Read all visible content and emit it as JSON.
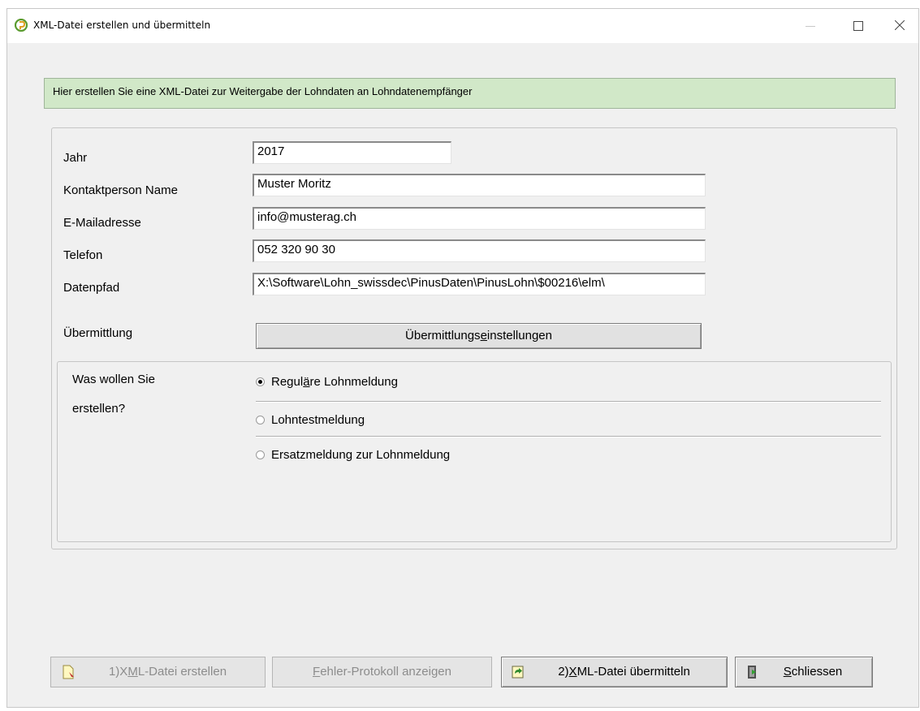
{
  "window": {
    "title": "XML-Datei erstellen und übermitteln"
  },
  "info": {
    "text": "Hier erstellen Sie eine XML-Datei zur Weitergabe der Lohndaten an Lohndatenempfänger"
  },
  "form": {
    "jahr_label": "Jahr",
    "jahr_value": "2017",
    "kontakt_label": "Kontaktperson Name",
    "kontakt_value": "Muster Moritz",
    "email_label": "E-Mailadresse",
    "email_value": "info@musterag.ch",
    "telefon_label": "Telefon",
    "telefon_value": "052 320 90 30",
    "pfad_label": "Datenpfad",
    "pfad_value": "X:\\Software\\Lohn_swissdec\\PinusDaten\\PinusLohn\\$00216\\elm\\",
    "uebermittlung_label": "Übermittlung",
    "settings_button": {
      "pre": "Übermittlungs",
      "key": "e",
      "post": "instellungen"
    }
  },
  "options": {
    "question_line1": "Was wollen Sie",
    "question_line2": "erstellen?",
    "items": [
      {
        "pre": "Regul",
        "key": "ä",
        "post": "re Lohnmeldung",
        "checked": true
      },
      {
        "pre": "Lohntestmeldung",
        "key": "",
        "post": "",
        "checked": false
      },
      {
        "pre": "Ersatzmeldung zur Lohnmeldung",
        "key": "",
        "post": "",
        "checked": false
      }
    ]
  },
  "buttons": {
    "create": {
      "pre": "1)X",
      "key": "M",
      "post": "L-Datei erstellen",
      "enabled": false
    },
    "log": {
      "pre": "",
      "key": "F",
      "post": "ehler-Protokoll anzeigen",
      "enabled": false
    },
    "send": {
      "pre": "2)",
      "key": "X",
      "post": "ML-Datei übermitteln",
      "enabled": true
    },
    "close": {
      "pre": "",
      "key": "S",
      "post": "chliessen",
      "enabled": true
    }
  },
  "colors": {
    "info_bg": "#d1e8c8",
    "window_bg": "#f0f0f0",
    "app_icon": "#5a9b2e"
  },
  "icons": {
    "app": "pinus-app-icon",
    "create": "document-icon",
    "send": "send-arrow-icon",
    "close": "exit-door-icon"
  }
}
